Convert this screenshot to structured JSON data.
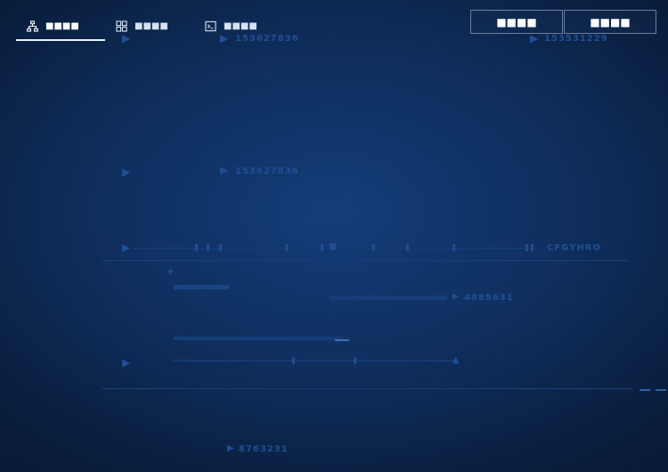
{
  "tabs": [
    {
      "label": "■■■■",
      "icon": "network-icon"
    },
    {
      "label": "■■■■",
      "icon": "grid-icon"
    },
    {
      "label": "■■■■",
      "icon": "terminal-icon"
    }
  ],
  "actions": {
    "button1_label": "■■■■",
    "button2_label": "■■■■"
  },
  "background_labels": {
    "id_top": "153627836",
    "id_top_right": "153531229",
    "id_mid": "153627836",
    "code_right": "CFGYHRO",
    "bar_value": "4885631",
    "bottom_value": "8763231"
  },
  "colors": {
    "background": "#0f2f5f",
    "accent_underline": "#e9f0fa",
    "button_border": "#6b7f9c",
    "deco_text": "#1f4f95"
  }
}
